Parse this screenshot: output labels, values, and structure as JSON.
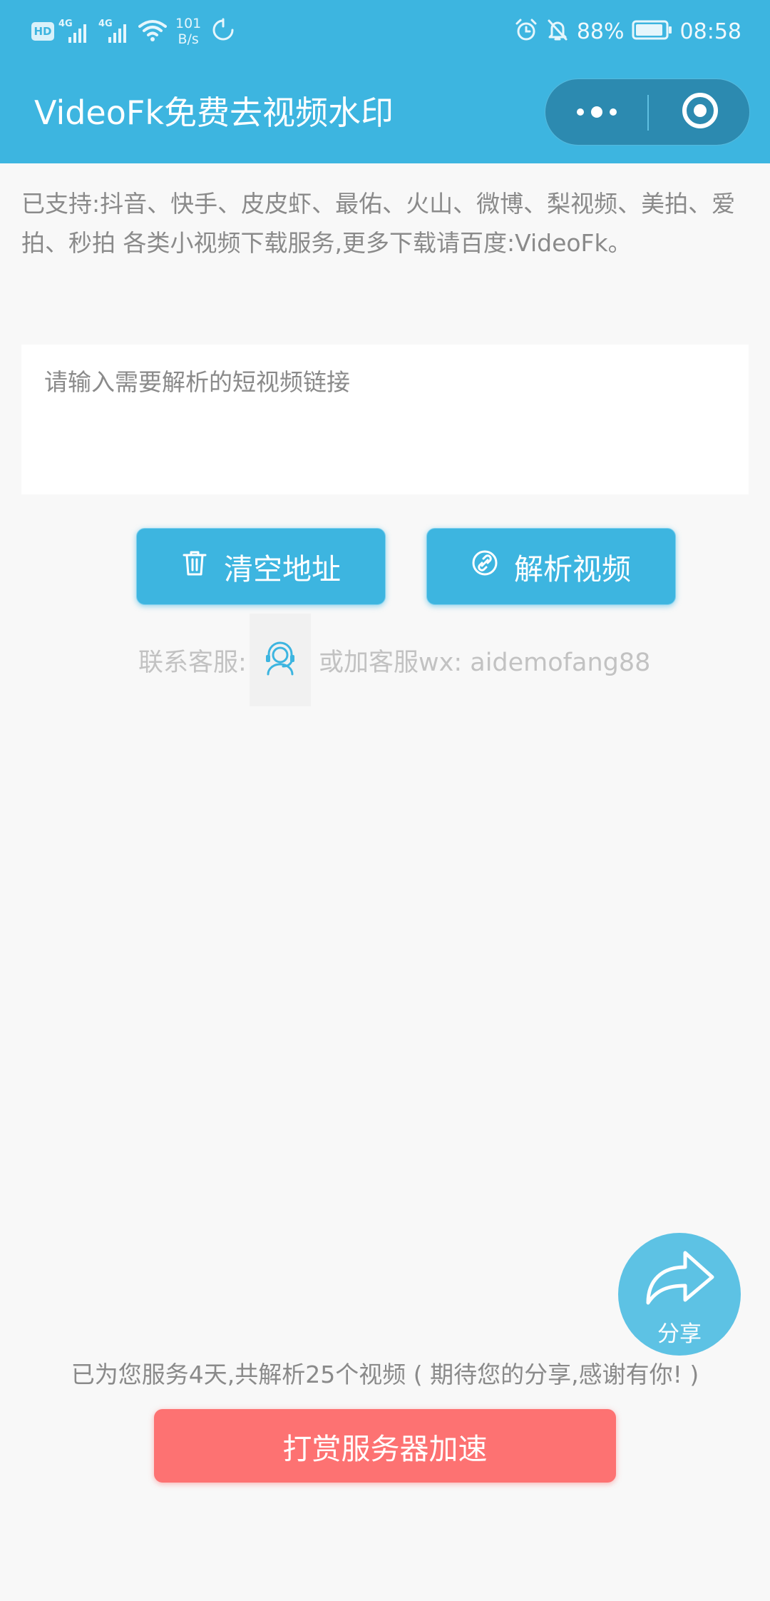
{
  "status_bar": {
    "hd_badge": "HD",
    "network_1": "4G",
    "network_2": "4G",
    "speed_value": "101",
    "speed_unit": "B/s",
    "battery_percent": "88%",
    "time": "08:58",
    "icons": [
      "wifi-icon",
      "data-saver-icon",
      "alarm-icon",
      "bell-muted-icon",
      "battery-icon"
    ]
  },
  "navbar": {
    "title": "VideoFk免费去视频水印",
    "capsule_icons": [
      "more-dots-icon",
      "close-target-icon"
    ]
  },
  "description": "已支持:抖音、快手、皮皮虾、最佑、火山、微博、梨视频、美拍、爱拍、秒拍 各类小视频下载服务,更多下载请百度:VideoFk。",
  "url_input": {
    "value": "",
    "placeholder": "请输入需要解析的短视频链接"
  },
  "buttons": {
    "clear_label": "清空地址",
    "clear_icon": "trash-icon",
    "parse_label": "解析视频",
    "parse_icon": "link-icon"
  },
  "contact": {
    "label": "联系客服:",
    "icon": "customer-service-icon",
    "wx_text": "或加客服wx: aidemofang88"
  },
  "share": {
    "label": "分享",
    "icon": "share-arrow-icon"
  },
  "stats_text": "已为您服务4天,共解析25个视频 ( 期待您的分享,感谢有你! )",
  "donate_label": "打赏服务器加速",
  "colors": {
    "primary": "#3db5e0",
    "donate": "#fd7272",
    "background": "#f8f8f8"
  }
}
